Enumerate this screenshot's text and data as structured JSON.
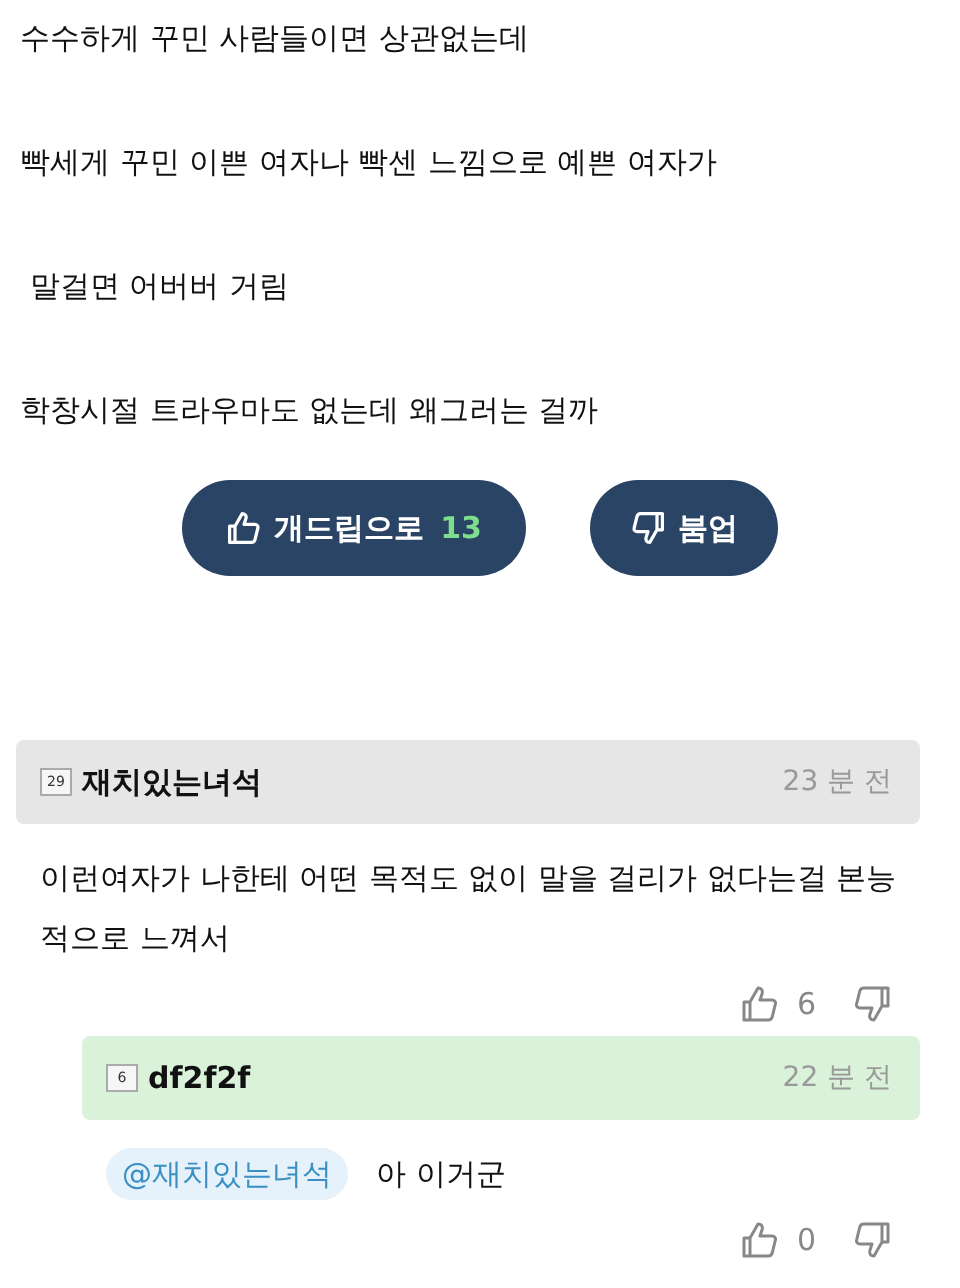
{
  "post": {
    "paragraphs": [
      "수수하게 꾸민 사람들이면 상관없는데",
      "빡세게 꾸민 이쁜 여자나 빡센 느낌으로 예쁜 여자가",
      " 말걸면 어버버 거림",
      "학창시절 트라우마도 없는데 왜그러는 걸까"
    ]
  },
  "vote_buttons": {
    "like": {
      "label": "개드립으로",
      "count": "13"
    },
    "dislike": {
      "label": "붐업"
    }
  },
  "comments": [
    {
      "kind": "comment",
      "level": "29",
      "author": "재치있는녀석",
      "time": "23 분 전",
      "text": "이런여자가 나한테 어떤 목적도 없이 말을 걸리가 없다는걸 본능적으로 느껴서",
      "likes": "6"
    },
    {
      "kind": "reply",
      "level": "6",
      "author": "df2f2f",
      "time": "22 분 전",
      "mention": "@재치있는녀석",
      "text": "아 이거군",
      "likes": "0"
    }
  ]
}
